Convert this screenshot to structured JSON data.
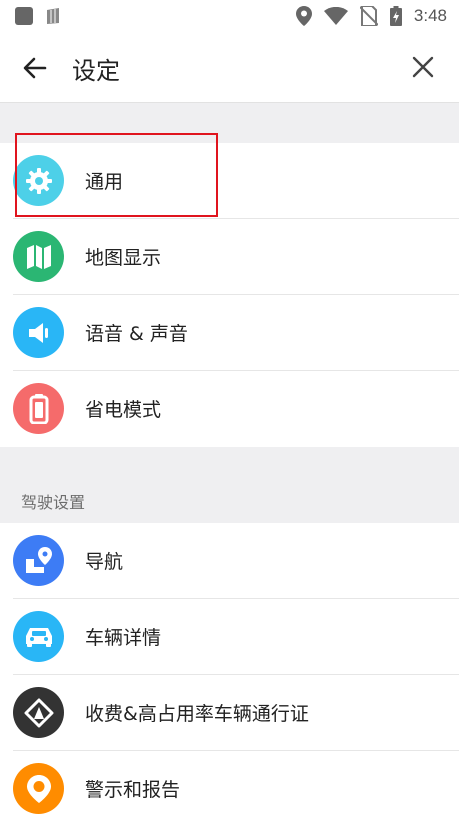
{
  "status_bar": {
    "time": "3:48",
    "icons": [
      "app-square-icon",
      "sd-card-icon",
      "location-icon",
      "wifi-icon",
      "no-sim-icon",
      "battery-charging-icon"
    ]
  },
  "app_bar": {
    "title": "设定",
    "back_icon": "arrow-left-icon",
    "close_icon": "close-icon"
  },
  "general_section": {
    "items": [
      {
        "label": "通用",
        "icon": "gear-icon",
        "color": "#4dd0e8"
      },
      {
        "label": "地图显示",
        "icon": "map-icon",
        "color": "#2bb673"
      },
      {
        "label": "语音 & 声音",
        "icon": "speaker-icon",
        "color": "#29b6f6"
      },
      {
        "label": "省电模式",
        "icon": "battery-icon",
        "color": "#f56b6b"
      }
    ]
  },
  "driving_section": {
    "header": "驾驶设置",
    "items": [
      {
        "label": "导航",
        "icon": "route-icon",
        "color": "#3d7cf5"
      },
      {
        "label": "车辆详情",
        "icon": "car-icon",
        "color": "#29b6f6"
      },
      {
        "label": "收费&高占用率车辆通行证",
        "icon": "toll-diamond-icon",
        "color": "#333333"
      },
      {
        "label": "警示和报告",
        "icon": "alert-pin-icon",
        "color": "#ff8c00"
      }
    ]
  },
  "annotation": {
    "highlight_color": "#e0141e"
  }
}
